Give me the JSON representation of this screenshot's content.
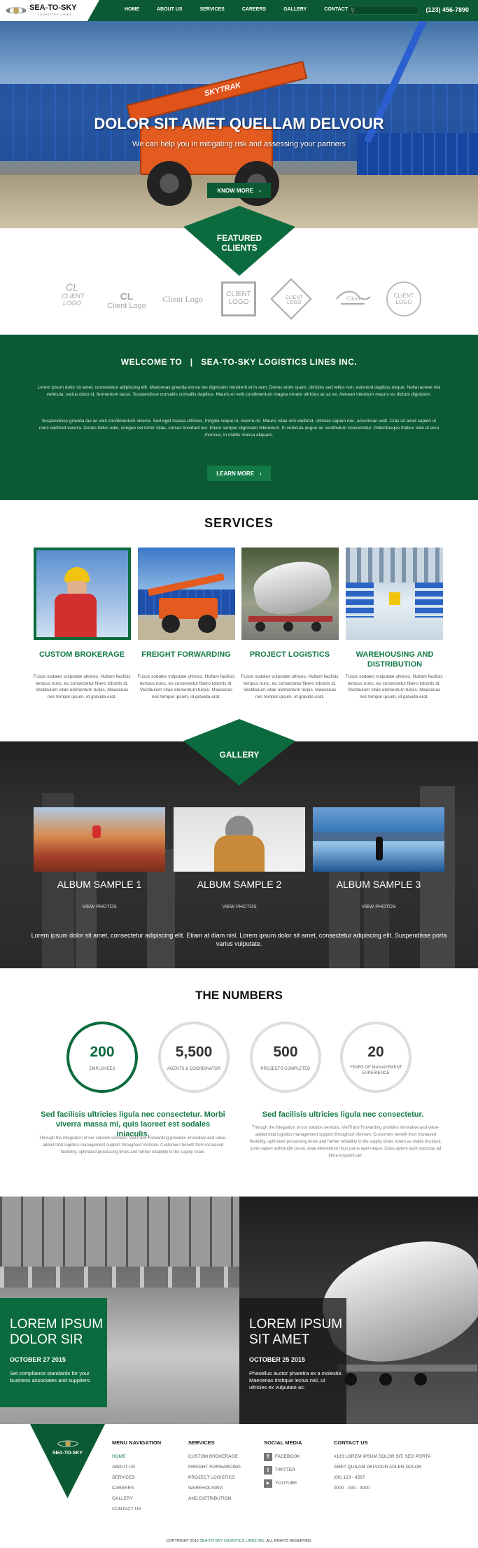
{
  "header": {
    "brand": "SEA-TO-SKY",
    "brand_sub": "LOGISTICS LINES",
    "nav": [
      "HOME",
      "ABOUT US",
      "SERVICES",
      "CAREERS",
      "GALLERY",
      "CONTACT US"
    ],
    "search_placeholder": "",
    "phone": "(123) 456-7890"
  },
  "hero": {
    "title": "DOLOR SIT AMET QUELLAM DELVOUR",
    "subtitle": "We can help you in mitigating risk and assessing your partners",
    "button": "KNOW MORE",
    "vehicle_text": "SKYTRAK"
  },
  "featured": {
    "label_1": "FEATURED",
    "label_2": "CLIENTS"
  },
  "clients": [
    {
      "line1": "CL",
      "line2": "CLIENT LOGO"
    },
    {
      "line1": "CL",
      "line2": "Client Logo"
    },
    {
      "line1": "",
      "line2": "Client Logo"
    },
    {
      "line1": "CLIENT",
      "line2": "LOGO"
    },
    {
      "line1": "CLIENT",
      "line2": "LOGO"
    },
    {
      "line1": "",
      "line2": "Client"
    },
    {
      "line1": "CLIENT",
      "line2": "LOGO"
    }
  ],
  "welcome": {
    "left": "WELCOME TO",
    "sep": "|",
    "right": "SEA-TO-SKY LOGISTICS LINES INC.",
    "p1": "Lorem ipsum dolor sit amet, consectetur adipiscing elit. Maecenas gravida est eu leo dignissim hendrerit et in sem. Donec enim quam, ultricies sed tellus non, euismod dapibus neque. Nulla laoreet nisl vehicula, varius dolor id, fermentum lacus. Suspendisse convallis convallis dapibus. Mauris et velit condimentum magna ornare ultricies ac ac ex. Aenean interdum mauris eu dictum dignissim.",
    "p2": "Suspendisse gravida dui ac velit condimentum viverra. Sed eget massa ultricies, fringilla neque in, viverra mi. Mauris vitae orci eleifend, ultricies sapien nec, accumsan velit. Cras sit amet sapien ut nunc eleifend viverra. Donec tellus odio, congue vel tortor vitae, cursus tincidunt leo. Etiam semper dignissim bibendum. In vehicula augue ac vestibulum consectetur. Pellentesque finibus odio id arcu rhoncus, in mattis massa aliquam.",
    "button": "LEARN MORE"
  },
  "services": {
    "title": "SERVICES",
    "items": [
      {
        "name": "CUSTOM BROKERAGE",
        "desc": "Fusce sodales vulputate ultrices. Nullam facilisis tempus nunc, eu consectetur libero lobortis id. Vestibulum vitae elementum turpis. Maecenas nec tempor ipsum, id gravida erat."
      },
      {
        "name": "FREIGHT FORWARDING",
        "desc": "Fusce sodales vulputate ultrices. Nullam facilisis tempus nunc, eu consectetur libero lobortis id. Vestibulum vitae elementum turpis. Maecenas nec tempor ipsum, id gravida erat."
      },
      {
        "name": "PROJECT LOGISTICS",
        "desc": "Fusce sodales vulputate ultrices. Nullam facilisis tempus nunc, eu consectetur libero lobortis id. Vestibulum vitae elementum turpis. Maecenas nec tempor ipsum, id gravida erat."
      },
      {
        "name": "WAREHOUSING AND DISTRIBUTION",
        "desc": "Fusce sodales vulputate ultrices. Nullam facilisis tempus nunc, eu consectetur libero lobortis id. Vestibulum vitae elementum turpis. Maecenas nec tempor ipsum, id gravida erat."
      }
    ]
  },
  "gallery": {
    "label": "GALLERY",
    "albums": [
      {
        "title": "ALBUM SAMPLE 1",
        "link": "VIEW PHOTOS"
      },
      {
        "title": "ALBUM SAMPLE 2",
        "link": "VIEW PHOTOS"
      },
      {
        "title": "ALBUM SAMPLE 3",
        "link": "VIEW PHOTOS"
      }
    ],
    "caption": "Lorem ipsum dolor sit amet, consectetur adipiscing elit. Etiam at diam nisl. Lorem ipsum dolor sit amet, consectetur adipiscing elit. Suspendisse porta varius vulputate."
  },
  "numbers": {
    "title": "THE NUMBERS",
    "stats": [
      {
        "value": "200",
        "label": "EMPLOYEES"
      },
      {
        "value": "5,500",
        "label": "AGENTS & COORDINATOR"
      },
      {
        "value": "500",
        "label": "PROJECTS COMPLETED"
      },
      {
        "value": "20",
        "label": "YEARS OF MANAGEMENT EXPERIENCE"
      }
    ],
    "left_head": "Sed facilisis ultricies ligula nec consectetur. Morbi viverra massa mi, quis laoreet est sodales iniaculis,",
    "left_text": "Through the integration of our solution services, VietTrans Forwarding provides innovative and value-added total logistics management support throughout Vietnam. Customers benefit from increased flexibility, optimized processing times and further reliability in the supply chain.",
    "right_head": "Sed facilisis ultricies ligula nec consectetur.",
    "right_text": "Through the integration of our solution services, VietTrans Forwarding provides innovative and value-added total logistics management support throughout Vietnam. Customers benefit from increased flexibility, optimized processing times and further reliability in the supply chain. lorem as mattis tincidunt, justo sapien sollicitudin purus, vitae elementum risus purus eget neque. Class aptent taciti sociosqu ad litora torquent per."
  },
  "promos": [
    {
      "title1": "LOREM IPSUM",
      "title2": "DOLOR SIR",
      "date": "OCTOBER 27 2015",
      "text": "Set compliance standards for your business associates and suppliers."
    },
    {
      "title1": "LOREM IPSUM",
      "title2": "SIT AMET",
      "date": "OCTOBER 25 2015",
      "text": "Phasellus auctor pharetra ex a molestie. Maecenas tristique lectus nisi, ut ultricies ex vulputate ac."
    }
  ],
  "footer": {
    "brand": "SEA-TO-SKY",
    "menu_head": "MENU NAVIGATION",
    "menu": [
      "HOME",
      "ABOUT US",
      "SERVICES",
      "CAREERS",
      "GALLERY",
      "CONTACT US"
    ],
    "services_head": "SERVICES",
    "services": [
      "CUSTOM BROKERAGE",
      "FREIGHT FORWARDING",
      "PROJECT LOGISTICS",
      "WAREHOUSING",
      "AND DISTRIBUTION"
    ],
    "social_head": "SOCIAL MEDIA",
    "social": [
      "FACEBOOK",
      "TWITTER",
      "YOUTUBE"
    ],
    "contact_head": "CONTACT US",
    "contact": [
      "#123 LOREM IPSUM DOLOR SIT, SED PORTA",
      "AMET QUILAM DELVOUR ADLER DOLOR",
      "(00) 123 - 4567",
      "0000 - 000 - 0000"
    ],
    "copyright_pre": "COPYRIGHT 2015",
    "copyright_brand": "SEA-TO-SKY LOGISTICS LINES INC.",
    "copyright_post": "ALL RIGHTS RESERVED."
  },
  "colors": {
    "primary_green": "#0b5a34",
    "accent_green": "#137a47"
  }
}
